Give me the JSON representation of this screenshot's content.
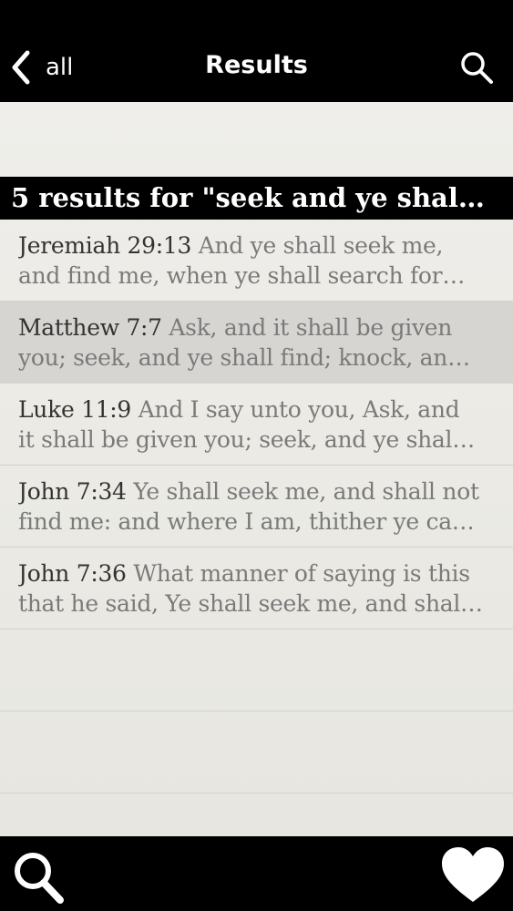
{
  "navbar": {
    "back_label": "all",
    "title": "Results",
    "back_icon": "chevron-left-icon",
    "search_icon": "search-icon"
  },
  "section_header": "5 results for \"seek and ye shal…",
  "results": [
    {
      "reference": "Jeremiah 29:13",
      "line1_text": " And ye shall seek me,",
      "line2": "and find me, when ye shall search for…",
      "selected": false
    },
    {
      "reference": "Matthew 7:7",
      "line1_text": " Ask, and it shall be given",
      "line2": "you; seek, and ye shall find; knock, an…",
      "selected": true
    },
    {
      "reference": "Luke 11:9",
      "line1_text": " And I say unto you, Ask, and",
      "line2": "it shall be given you; seek, and ye shal…",
      "selected": false
    },
    {
      "reference": "John 7:34",
      "line1_text": " Ye shall seek me, and shall not",
      "line2": "find me: and where I am, thither ye ca…",
      "selected": false
    },
    {
      "reference": "John 7:36",
      "line1_text": " What manner of saying is this",
      "line2": "that he said, Ye shall seek me, and shal…",
      "selected": false
    }
  ],
  "tabbar": {
    "search_icon": "search-icon",
    "favorites_icon": "heart-icon"
  },
  "colors": {
    "bar_background": "#000000",
    "page_background": "#ecebe6",
    "selected_row": "#d6d5d1",
    "reference_text": "#333333",
    "verse_text": "#7a7a7a"
  }
}
